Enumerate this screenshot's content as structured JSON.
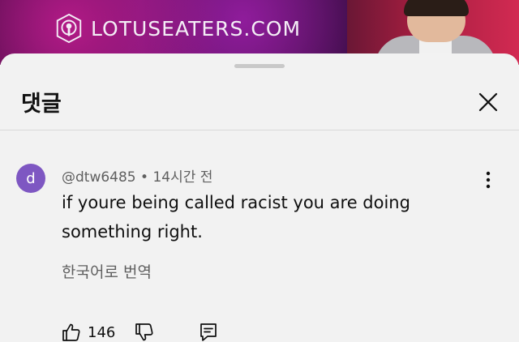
{
  "video": {
    "banner_text": "LOTUSEATERS.COM"
  },
  "sheet": {
    "title": "댓글"
  },
  "comment": {
    "avatar_letter": "d",
    "author": "@dtw6485",
    "separator": "•",
    "time": "14시간 전",
    "text": "if youre being called racist you are doing something right.",
    "translate_label": "한국어로 번역",
    "like_count": "146"
  },
  "colors": {
    "avatar": "#7e57c2",
    "sheet_background": "#f2f2f2",
    "text_primary": "#0f0f0f",
    "text_secondary": "#5f5f5f"
  },
  "icons": [
    "podcast-icon",
    "close-icon",
    "more-vert-icon",
    "thumbs-up-icon",
    "thumbs-down-icon",
    "reply-icon"
  ]
}
